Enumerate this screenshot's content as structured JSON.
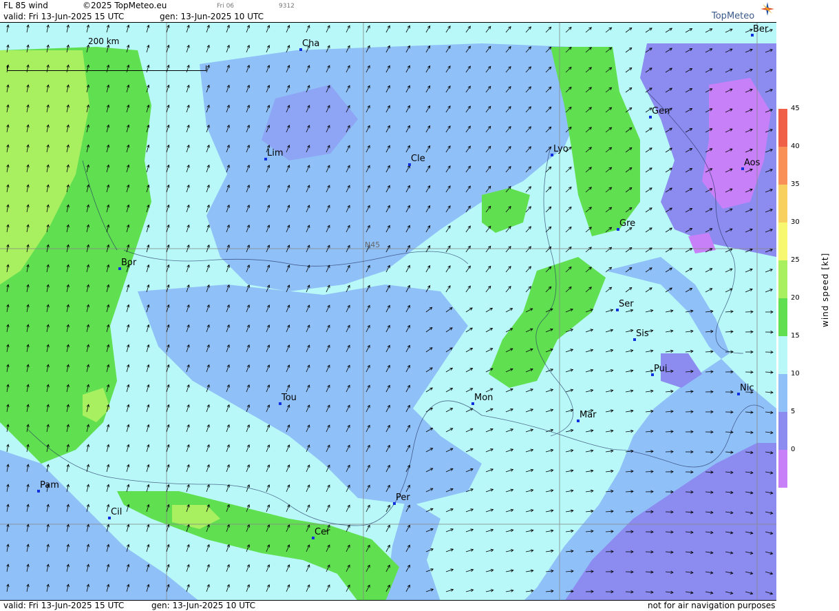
{
  "header": {
    "title": "FL 85 wind",
    "copyright": "©2025 TopMeteo.eu",
    "valid": "valid:  Fri  13-Jun-2025  15 UTC",
    "gen": "gen: 13-Jun-2025 10 UTC",
    "run": "Fri 06",
    "code": "9312"
  },
  "logo": {
    "text": "TopMeteo"
  },
  "scale_bar": {
    "label": "200 km"
  },
  "grid_label": "N45",
  "cities": [
    {
      "name": "Ber"
    },
    {
      "name": "Cha"
    },
    {
      "name": "Gen"
    },
    {
      "name": "Lim"
    },
    {
      "name": "Cle"
    },
    {
      "name": "Lyo"
    },
    {
      "name": "Aos"
    },
    {
      "name": "Gre"
    },
    {
      "name": "Bor"
    },
    {
      "name": "Ser"
    },
    {
      "name": "Sis"
    },
    {
      "name": "Pui"
    },
    {
      "name": "Tou"
    },
    {
      "name": "Mon"
    },
    {
      "name": "Mar"
    },
    {
      "name": "Nic"
    },
    {
      "name": "Pam"
    },
    {
      "name": "Cil"
    },
    {
      "name": "Per"
    },
    {
      "name": "Cer"
    }
  ],
  "legend": {
    "label": "wind speed [kt]",
    "ticks": [
      "45",
      "40",
      "35",
      "30",
      "25",
      "20",
      "15",
      "10",
      "5",
      "0"
    ],
    "colors": [
      "#f06048",
      "#f89058",
      "#f8d060",
      "#f8f870",
      "#a8f060",
      "#60e050",
      "#b8f8f8",
      "#90c0f8",
      "#8c8cf0",
      "#c880f8"
    ]
  },
  "footer": {
    "valid": "valid:  Fri  13-Jun-2025  15 UTC",
    "gen": "gen: 13-Jun-2025 10 UTC",
    "note": "not for air navigation purposes"
  }
}
